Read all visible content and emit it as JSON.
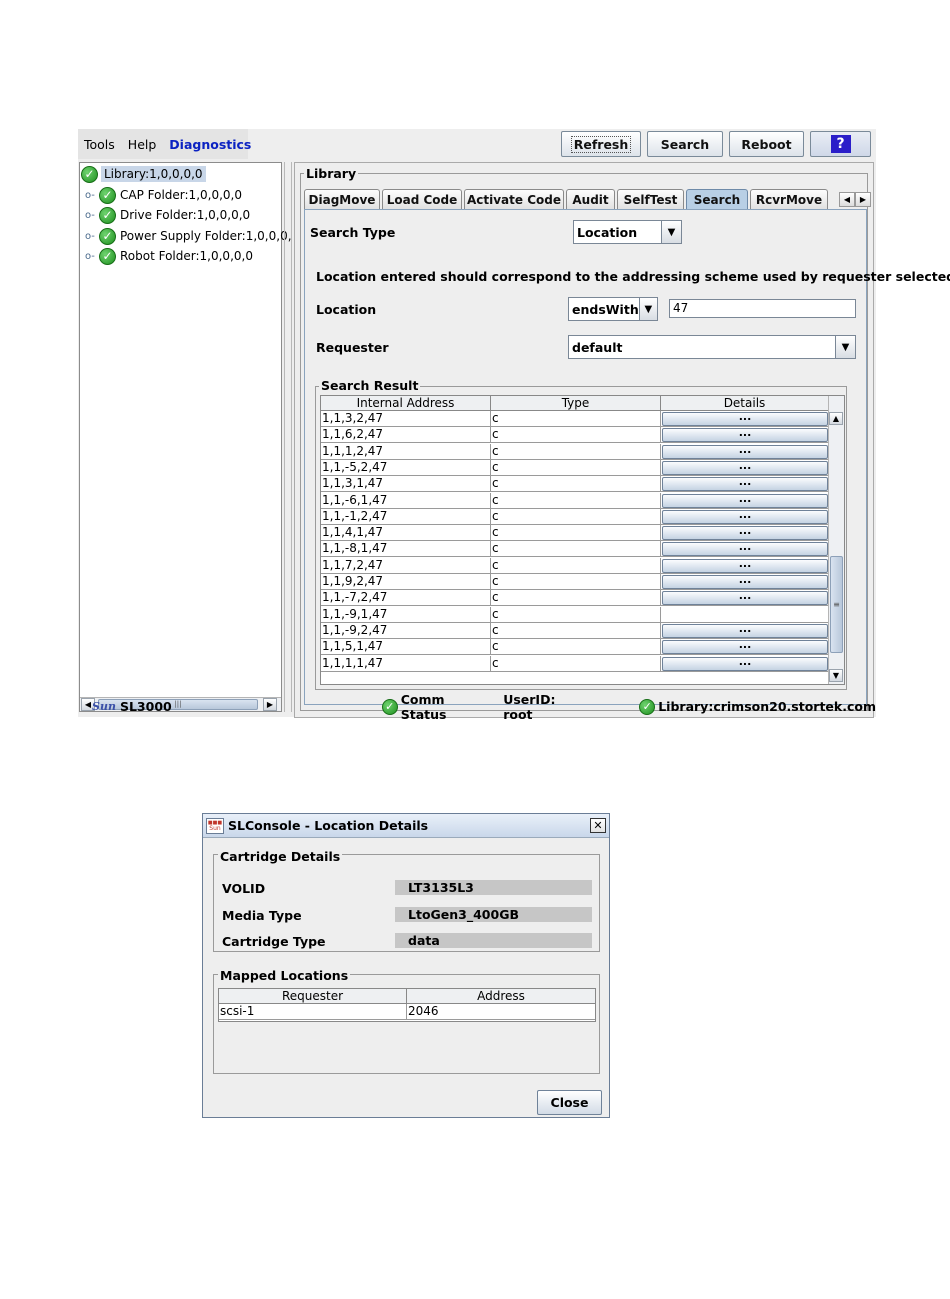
{
  "menubar": {
    "items": [
      "Tools",
      "Help",
      "Diagnostics"
    ]
  },
  "toolbar": {
    "refresh_label": "Refresh",
    "search_label": "Search",
    "reboot_label": "Reboot",
    "help_label": "?"
  },
  "tree": {
    "root": "Library:1,0,0,0,0",
    "children": [
      "CAP Folder:1,0,0,0,0",
      "Drive Folder:1,0,0,0,0",
      "Power Supply Folder:1,0,0,0,",
      "Robot Folder:1,0,0,0,0"
    ]
  },
  "library": {
    "title": "Library",
    "tabs": [
      "DiagMove",
      "Load Code",
      "Activate Code",
      "Audit",
      "SelfTest",
      "Search",
      "RcvrMove"
    ],
    "active_tab": "Search",
    "search_type_label": "Search Type",
    "search_type_value": "Location",
    "instruction": "Location entered should correspond to the addressing scheme used by requester selected.",
    "location_label": "Location",
    "location_operator": "endsWith",
    "location_value": "47",
    "requester_label": "Requester",
    "requester_value": "default",
    "search_result_title": "Search Result",
    "columns": [
      "Internal Address",
      "Type",
      "Details"
    ],
    "details_button_label": "...",
    "rows": [
      {
        "address": "1,1,3,2,47",
        "type": "c",
        "details": true
      },
      {
        "address": "1,1,6,2,47",
        "type": "c",
        "details": true
      },
      {
        "address": "1,1,1,2,47",
        "type": "c",
        "details": true
      },
      {
        "address": "1,1,-5,2,47",
        "type": "c",
        "details": true
      },
      {
        "address": "1,1,3,1,47",
        "type": "c",
        "details": true
      },
      {
        "address": "1,1,-6,1,47",
        "type": "c",
        "details": true
      },
      {
        "address": "1,1,-1,2,47",
        "type": "c",
        "details": true
      },
      {
        "address": "1,1,4,1,47",
        "type": "c",
        "details": true
      },
      {
        "address": "1,1,-8,1,47",
        "type": "c",
        "details": true
      },
      {
        "address": "1,1,7,2,47",
        "type": "c",
        "details": true
      },
      {
        "address": "1,1,9,2,47",
        "type": "c",
        "details": true
      },
      {
        "address": "1,1,-7,2,47",
        "type": "c",
        "details": true
      },
      {
        "address": "1,1,-9,1,47",
        "type": "c",
        "details": false
      },
      {
        "address": "1,1,-9,2,47",
        "type": "c",
        "details": true
      },
      {
        "address": "1,1,5,1,47",
        "type": "c",
        "details": true
      },
      {
        "address": "1,1,1,1,47",
        "type": "c",
        "details": true
      }
    ]
  },
  "statusbar": {
    "product": "SL3000",
    "logo_text": "Sun",
    "comm_status": "Comm Status",
    "user": "UserID: root",
    "library_host": "Library:crimson20.stortek.com"
  },
  "dialog": {
    "title": "SLConsole - Location Details",
    "icon_text": "Sun",
    "close_glyph": "✕",
    "cartridge_group_title": "Cartridge Details",
    "fields": [
      {
        "label": "VOLID",
        "value": "LT3135L3"
      },
      {
        "label": "Media Type",
        "value": "LtoGen3_400GB"
      },
      {
        "label": "Cartridge Type",
        "value": "data"
      }
    ],
    "mapped_group_title": "Mapped Locations",
    "mapped_columns": [
      "Requester",
      "Address"
    ],
    "mapped_rows": [
      {
        "requester": "scsi-1",
        "address": "2046"
      }
    ],
    "close_button_label": "Close"
  },
  "colors": {
    "accent": "#0b22c2",
    "ok_green": "#1e8f1e",
    "selected_tab": "#b8cfe5",
    "readonly_field": "#c6c6c6"
  }
}
